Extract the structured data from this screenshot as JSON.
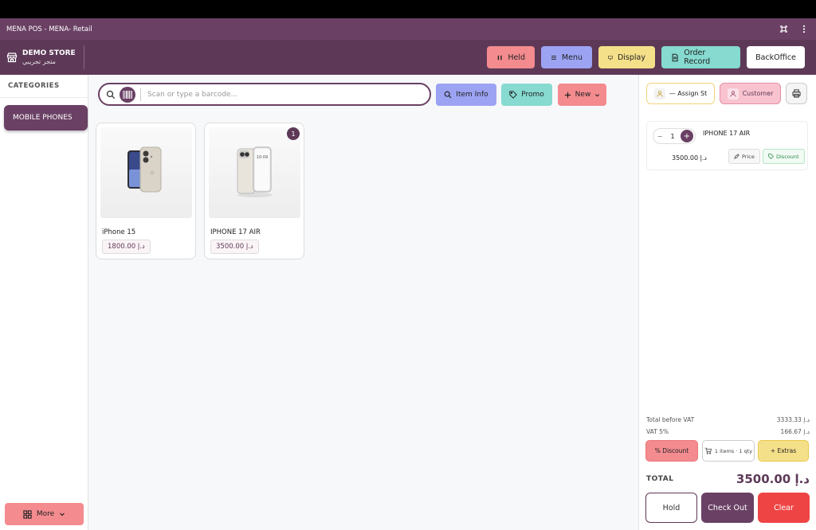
{
  "window": {
    "title": "MENA POS - MENA- Retail"
  },
  "store": {
    "name": "DEMO STORE",
    "subtitle": "متجر تجريبي"
  },
  "header_buttons": {
    "held": "Held",
    "menu": "Menu",
    "display": "Display",
    "order_record": "Order Record",
    "backoffice": "BackOffice"
  },
  "sidebar": {
    "title": "CATEGORIES",
    "active_category": "MOBILE PHONES",
    "more": "More"
  },
  "search": {
    "placeholder": "Scan or type a barcode..."
  },
  "actions": {
    "item_info": "Item Info",
    "promo": "Promo",
    "new": "New"
  },
  "products": [
    {
      "name": "iPhone 15",
      "price": "1800.00 د.إ",
      "badge": ""
    },
    {
      "name": "IPHONE 17 AIR",
      "price": "3500.00 د.إ",
      "badge": "1"
    }
  ],
  "cart": {
    "assign": "— Assign St",
    "customer": "Customer",
    "lines": [
      {
        "qty": "1",
        "name": "IPHONE 17 AIR",
        "price": "3500.00 د.إ",
        "price_btn": "Price",
        "discount_btn": "Discount"
      }
    ],
    "total_before_vat_label": "Total before VAT",
    "total_before_vat": "3333.33 د.إ",
    "vat_label": "VAT 5%",
    "vat": "166.67 د.إ",
    "discount_btn": "% Discount",
    "items_summary": "1 items · 1 qty",
    "extras_btn": "+ Extras",
    "total_label": "TOTAL",
    "total": "3500.00 د.إ",
    "hold": "Hold",
    "checkout": "Check Out",
    "clear": "Clear"
  },
  "colors": {
    "primary": "#6a4064",
    "header": "#5d3957",
    "held": "#f38b8f",
    "menu": "#9ca3f3",
    "display": "#f5e08a",
    "order_record": "#86dad0",
    "clear": "#ef4444"
  }
}
